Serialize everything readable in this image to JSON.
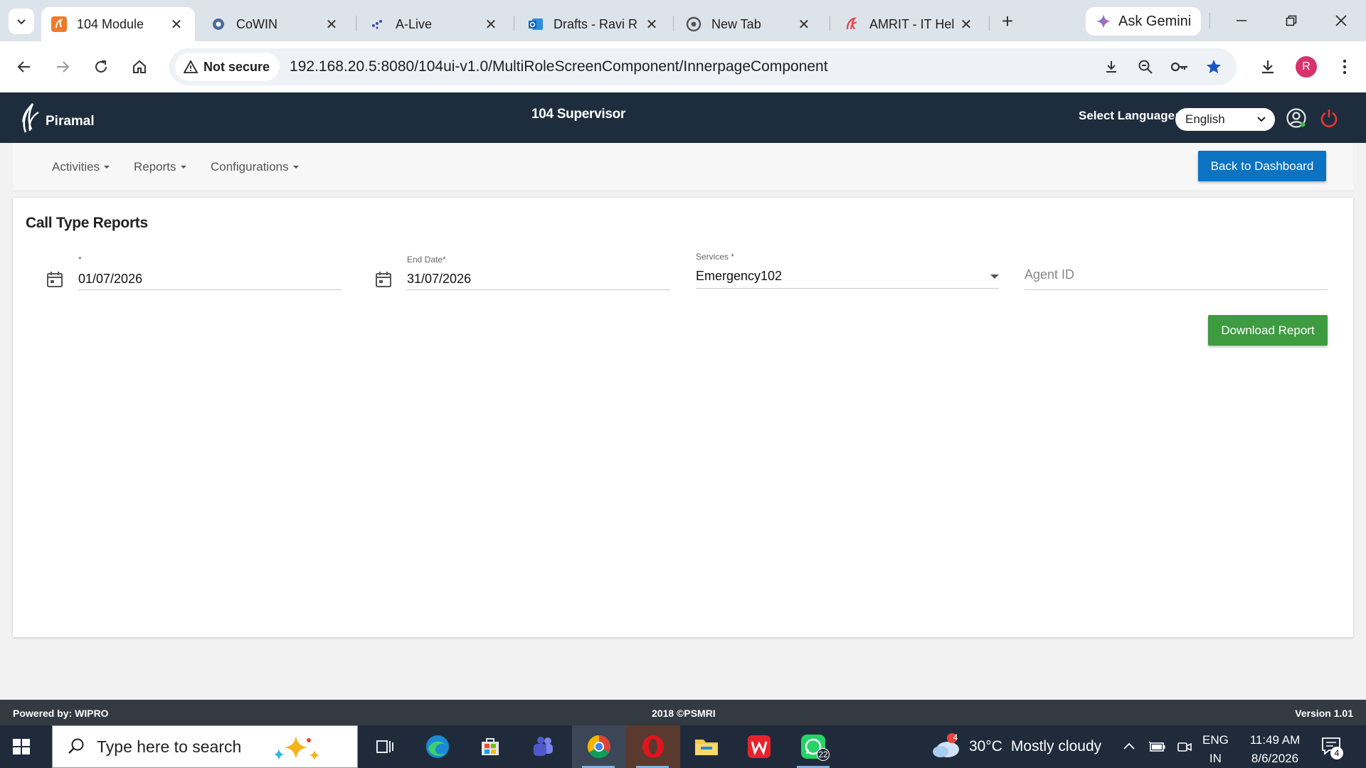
{
  "browser": {
    "tabs": [
      {
        "label": "104 Module",
        "active": true
      },
      {
        "label": "CoWIN"
      },
      {
        "label": "A-Live"
      },
      {
        "label": "Drafts - Ravi R"
      },
      {
        "label": "New Tab"
      },
      {
        "label": "AMRIT - IT Hel"
      }
    ],
    "gemini_label": "Ask Gemini",
    "security_label": "Not secure",
    "url": "192.168.20.5:8080/104ui-v1.0/MultiRoleScreenComponent/InnerpageComponent",
    "profile_initial": "R"
  },
  "header": {
    "brand": "Piramal",
    "title": "104 Supervisor",
    "language_label": "Select Language:",
    "language_value": "English"
  },
  "menu": {
    "items": [
      "Activities",
      "Reports",
      "Configurations"
    ],
    "back_button": "Back to Dashboard"
  },
  "report": {
    "title": "Call Type Reports",
    "start_date": {
      "label": "*",
      "value": "01/07/2026"
    },
    "end_date": {
      "label": "End Date*",
      "value": "31/07/2026"
    },
    "services": {
      "label": "Services *",
      "value": "Emergency102"
    },
    "agent_id": {
      "placeholder": "Agent ID"
    },
    "download_button": "Download Report"
  },
  "footer": {
    "powered_by": "Powered by: WIPRO",
    "copyright": "2018 ©PSMRI",
    "version": "Version 1.01"
  },
  "taskbar": {
    "search_placeholder": "Type here to search",
    "weather_temp": "30°C",
    "weather_desc": "Mostly cloudy",
    "weather_badge": "4",
    "whatsapp_badge": "22",
    "lang_line1": "ENG",
    "lang_line2": "IN",
    "time": "11:49 AM",
    "date": "8/6/2026",
    "notification_count": "4"
  }
}
